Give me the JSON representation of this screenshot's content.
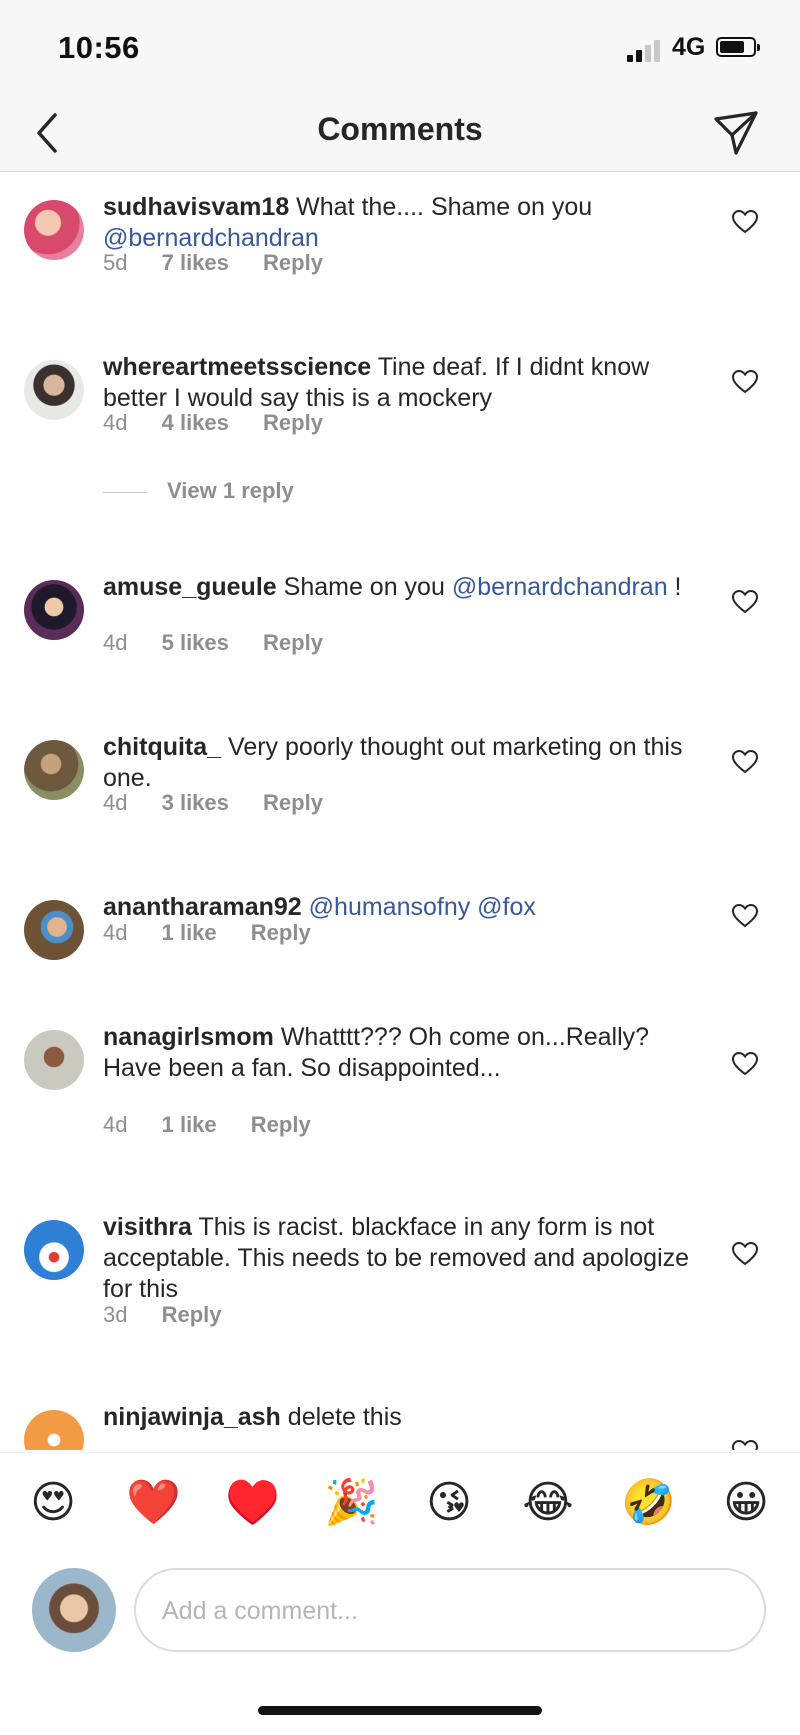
{
  "status_bar": {
    "time": "10:56",
    "network": "4G"
  },
  "header": {
    "title": "Comments"
  },
  "comments": [
    {
      "user": "sudhavisvam18",
      "text": "What the.... Shame on you",
      "mention": "@bernardchandran",
      "suffix": "",
      "time": "5d",
      "likes": "7 likes",
      "reply": "Reply"
    },
    {
      "user": "whereartmeetsscience",
      "text": "Tine deaf. If I didnt know better I would say this is a mockery",
      "time": "4d",
      "likes": "4 likes",
      "reply": "Reply",
      "view_replies": "View 1 reply"
    },
    {
      "user": "amuse_gueule",
      "text": "Shame on you",
      "mention": "@bernardchandran",
      "suffix": " !",
      "time": "4d",
      "likes": "5 likes",
      "reply": "Reply"
    },
    {
      "user": "chitquita_",
      "text": "Very poorly thought out marketing on this one.",
      "time": "4d",
      "likes": "3 likes",
      "reply": "Reply"
    },
    {
      "user": "anantharaman92",
      "text": "",
      "mention": "@humansofny @fox",
      "suffix": "",
      "time": "4d",
      "likes": "1 like",
      "reply": "Reply"
    },
    {
      "user": "nanagirlsmom",
      "text": "Whatttt??? Oh come on...Really? Have been a fan. So disappointed...",
      "time": "4d",
      "likes": "1 like",
      "reply": "Reply"
    },
    {
      "user": "visithra",
      "text": "This is racist. blackface in any form is not acceptable. This needs to be removed and apologize for this",
      "time": "3d",
      "reply": "Reply"
    },
    {
      "user": "ninjawinja_ash",
      "text": "delete this"
    }
  ],
  "emoji_bar": [
    "😍",
    "❤️",
    "♥️",
    "🎉",
    "😘",
    "😂",
    "🤣",
    "😀"
  ],
  "composer": {
    "placeholder": "Add a comment..."
  },
  "colors": {
    "mention": "#385898",
    "meta": "#8e8e8e",
    "text": "#262626"
  }
}
